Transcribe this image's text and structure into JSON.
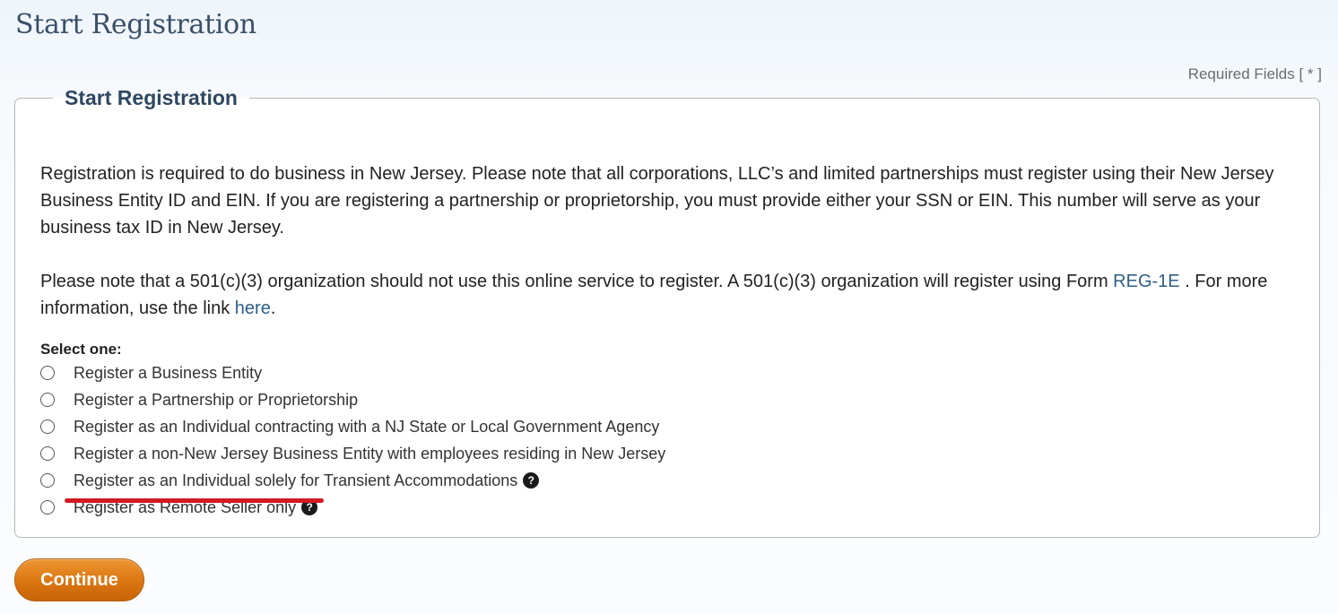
{
  "page": {
    "title": "Start Registration",
    "required_note": "Required Fields [ * ]"
  },
  "panel": {
    "legend": "Start Registration",
    "intro": "Registration is required to do business in New Jersey. Please note that all corporations, LLC’s and limited partnerships must register using their New Jersey Business Entity ID and EIN. If you are registering a partnership or proprietorship, you must provide either your SSN or EIN. This number will serve as your business tax ID in New Jersey.",
    "note_part1": "Please note that a 501(c)(3) organization should not use this online service to register. A 501(c)(3) organization will register using Form ",
    "note_link_form": "REG-1E",
    "note_part2": " . For more information, use the link ",
    "note_link_here": "here",
    "note_part3": ".",
    "select_label": "Select one:",
    "options": [
      {
        "label": "Register a Business Entity",
        "selected": false,
        "help": false
      },
      {
        "label": "Register a Partnership or Proprietorship",
        "selected": false,
        "help": false
      },
      {
        "label": "Register as an Individual contracting with a NJ State or Local Government Agency",
        "selected": false,
        "help": false
      },
      {
        "label": "Register a non-New Jersey Business Entity with employees residing in New Jersey",
        "selected": false,
        "help": false
      },
      {
        "label": "Register as an Individual solely for Transient Accommodations",
        "selected": false,
        "help": true
      },
      {
        "label": "Register as Remote Seller only",
        "selected": false,
        "help": true
      }
    ],
    "help_icon": "question-circle-icon",
    "help_glyph": "?"
  },
  "actions": {
    "continue_label": "Continue"
  },
  "colors": {
    "title": "#3a5068",
    "link": "#2d5f88",
    "button": "#db7510",
    "annotation": "#d11a23"
  }
}
